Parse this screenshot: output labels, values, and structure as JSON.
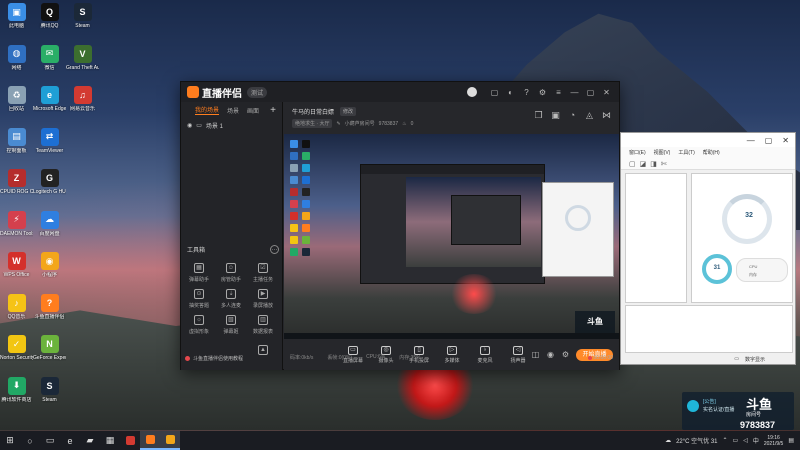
{
  "desktop": {
    "icons": [
      {
        "label": "此电脑",
        "color": "#3a8ee6",
        "glyph": "▣"
      },
      {
        "label": "腾讯QQ",
        "color": "#111111",
        "glyph": "Q"
      },
      {
        "label": "Steam",
        "color": "#1b2838",
        "glyph": "S"
      },
      {
        "label": "网络",
        "color": "#2f6fc1",
        "glyph": "◍"
      },
      {
        "label": "微信",
        "color": "#2aae67",
        "glyph": "✉"
      },
      {
        "label": "Grand Theft Auto V",
        "color": "#3c6e2f",
        "glyph": "V"
      },
      {
        "label": "回收站",
        "color": "#8aa1b4",
        "glyph": "♻"
      },
      {
        "label": "Microsoft Edge",
        "color": "#1f9fd6",
        "glyph": "e"
      },
      {
        "label": "网易云音乐",
        "color": "#d33a31",
        "glyph": "♫"
      },
      {
        "label": "控制面板",
        "color": "#4a8bd1",
        "glyph": "▤"
      },
      {
        "label": "TeamViewer",
        "color": "#1d6fd3",
        "glyph": "⇄"
      },
      {
        "label": "",
        "color": "",
        "glyph": ""
      },
      {
        "label": "CPUID ROG CPU-Z",
        "color": "#b52d2d",
        "glyph": "Z"
      },
      {
        "label": "Logitech G HUB",
        "color": "#222222",
        "glyph": "G"
      },
      {
        "label": "",
        "color": "",
        "glyph": ""
      },
      {
        "label": "DAEMON Tools Lite",
        "color": "#d4404d",
        "glyph": "⚡"
      },
      {
        "label": "百度网盘",
        "color": "#2f7fe0",
        "glyph": "☁"
      },
      {
        "label": "",
        "color": "",
        "glyph": ""
      },
      {
        "label": "WPS Office",
        "color": "#d4302b",
        "glyph": "W"
      },
      {
        "label": "小程序",
        "color": "#f3a61a",
        "glyph": "◉"
      },
      {
        "label": "",
        "color": "",
        "glyph": ""
      },
      {
        "label": "QQ音乐",
        "color": "#f5c316",
        "glyph": "♪"
      },
      {
        "label": "斗鱼直播伴侣",
        "color": "#ff7d1e",
        "glyph": "?"
      },
      {
        "label": "",
        "color": "",
        "glyph": ""
      },
      {
        "label": "Norton Security",
        "color": "#f2c612",
        "glyph": "✓"
      },
      {
        "label": "GeForce Experience",
        "color": "#6bb33c",
        "glyph": "N"
      },
      {
        "label": "",
        "color": "",
        "glyph": ""
      },
      {
        "label": "腾讯软件商店",
        "color": "#21a865",
        "glyph": "⬇"
      },
      {
        "label": "Steam",
        "color": "#1b2838",
        "glyph": "S"
      },
      {
        "label": "",
        "color": "",
        "glyph": ""
      }
    ]
  },
  "app": {
    "name": "直播伴侣",
    "version_badge": "测试",
    "left_tabs": [
      "我的场景",
      "场景",
      "画面"
    ],
    "scene_name": "场景 1",
    "tools_title": "工具箱",
    "tools": [
      {
        "label": "弹幕助手",
        "glyph": "▦"
      },
      {
        "label": "房管助手",
        "glyph": "☺"
      },
      {
        "label": "主播任务",
        "glyph": "☑"
      },
      {
        "label": "抽奖答题",
        "glyph": "⊙"
      },
      {
        "label": "多人连麦",
        "glyph": "⇣"
      },
      {
        "label": "录屏播放",
        "glyph": "▶"
      },
      {
        "label": "虚拟形象",
        "glyph": "☼"
      },
      {
        "label": "弹幕姬",
        "glyph": "▧"
      },
      {
        "label": "数据报表",
        "glyph": "▥"
      },
      {
        "label": "",
        "glyph": ""
      },
      {
        "label": "",
        "glyph": ""
      },
      {
        "label": "",
        "glyph": "▲"
      }
    ],
    "bottom_notice": "斗鱼直播伴侣使用教程",
    "room_title": "牛马的日常白嫖",
    "room_edit": "修改",
    "room_category": "绝地求生 · 大厅",
    "room_label": "小葫芦房间号",
    "room_id": "9783837",
    "bottom_tools": [
      {
        "label": "直播屏幕",
        "glyph": "▭"
      },
      {
        "label": "摄像头",
        "glyph": "◎"
      },
      {
        "label": "手机投屏",
        "glyph": "▯"
      },
      {
        "label": "多媒体",
        "glyph": "▷"
      },
      {
        "label": "麦克风",
        "glyph": "♭"
      },
      {
        "label": "扬声器",
        "glyph": "◁"
      }
    ],
    "start_live": "开始直播",
    "status": {
      "bitrate": "码率:0kb/s",
      "dropped": "丢帧:0(0%)",
      "cpu": "CPU:6%",
      "memory": "内存:35%",
      "timer": "00:00:00"
    },
    "preview_watermark": "斗鱼"
  },
  "monitor_window": {
    "menu": [
      "窗口(E)",
      "视图(V)",
      "工具(T)",
      "帮助(H)"
    ],
    "gauge_main": "32",
    "gauge_small": "31",
    "card_line1": "CPU",
    "card_line2": "内存",
    "footer": "数字显示"
  },
  "watermark": {
    "badge_text": "[公告]",
    "line2": "实名认证/直播",
    "brand": "斗鱼",
    "sub": "房间号",
    "room": "9783837"
  },
  "taskbar": {
    "items": [
      {
        "name": "start",
        "glyph": "⊞"
      },
      {
        "name": "search",
        "glyph": "○"
      },
      {
        "name": "task-view",
        "glyph": "▭"
      },
      {
        "name": "edge",
        "glyph": "e"
      },
      {
        "name": "explorer",
        "glyph": "▰"
      },
      {
        "name": "store",
        "glyph": "▦"
      },
      {
        "name": "app-red",
        "glyph": "■"
      },
      {
        "name": "douyu",
        "glyph": "■"
      },
      {
        "name": "orange-app",
        "glyph": "■"
      }
    ],
    "weather": "22°C 空气优 31",
    "time": "19:16",
    "date": "2021/9/5"
  }
}
